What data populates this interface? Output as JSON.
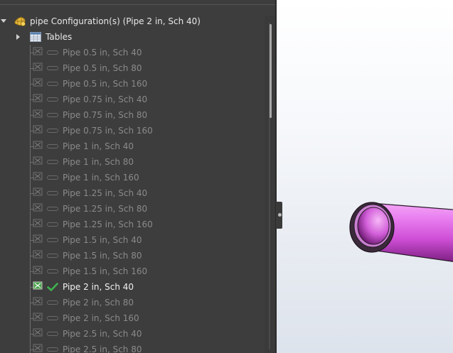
{
  "tree": {
    "root": {
      "label": "pipe Configuration(s)  (Pipe 2 in, Sch 40)",
      "icon": "configuration-folder-icon",
      "expanded": true
    },
    "tables": {
      "label": "Tables",
      "icon": "tables-icon",
      "expanded": false
    },
    "configurations": [
      {
        "label": "Pipe 0.5 in, Sch 40",
        "active": false
      },
      {
        "label": "Pipe 0.5 in, Sch 80",
        "active": false
      },
      {
        "label": "Pipe 0.5 in, Sch 160",
        "active": false
      },
      {
        "label": "Pipe 0.75 in, Sch 40",
        "active": false
      },
      {
        "label": "Pipe 0.75 in, Sch 80",
        "active": false
      },
      {
        "label": "Pipe 0.75 in, Sch 160",
        "active": false
      },
      {
        "label": "Pipe 1 in, Sch 40",
        "active": false
      },
      {
        "label": "Pipe 1 in, Sch 80",
        "active": false
      },
      {
        "label": "Pipe 1 in, Sch 160",
        "active": false
      },
      {
        "label": "Pipe 1.25 in, Sch 40",
        "active": false
      },
      {
        "label": "Pipe 1.25 in, Sch 80",
        "active": false
      },
      {
        "label": "Pipe 1.25 in, Sch 160",
        "active": false
      },
      {
        "label": "Pipe 1.5 in, Sch 40",
        "active": false
      },
      {
        "label": "Pipe 1.5 in, Sch 80",
        "active": false
      },
      {
        "label": "Pipe 1.5 in, Sch 160",
        "active": false
      },
      {
        "label": "Pipe 2 in, Sch 40",
        "active": true
      },
      {
        "label": "Pipe 2 in, Sch 80",
        "active": false
      },
      {
        "label": "Pipe 2 in, Sch 160",
        "active": false
      },
      {
        "label": "Pipe 2.5 in, Sch 40",
        "active": false
      },
      {
        "label": "Pipe 2.5 in, Sch 80",
        "active": false
      }
    ]
  },
  "colors": {
    "panel_bg": "#3d3d3d",
    "active_text": "#f2f2f2",
    "inactive_text": "#8a8a8a",
    "check_green": "#3fb34f",
    "pipe_magenta": "#e26be8"
  },
  "viewport": {
    "model": "pipe-3d-model"
  }
}
